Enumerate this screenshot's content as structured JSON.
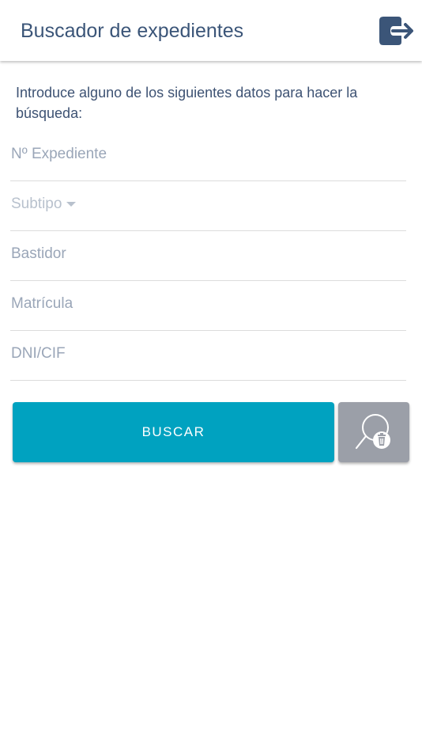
{
  "header": {
    "title": "Buscador de expedientes",
    "logout_icon": "logout-icon",
    "icon_color": "#3b5578"
  },
  "form": {
    "instructions": "Introduce alguno de los siguientes datos para hacer la búsqueda:",
    "expediente_placeholder": "Nº Expediente",
    "subtipo_label": "Subtipo",
    "bastidor_placeholder": "Bastidor",
    "matricula_placeholder": "Matrícula",
    "dni_placeholder": "DNI/CIF"
  },
  "actions": {
    "search_label": "BUSCAR",
    "search_color": "#00a2c0",
    "clear_icon": "clear-search-icon",
    "clear_color": "#9b9fa8"
  }
}
